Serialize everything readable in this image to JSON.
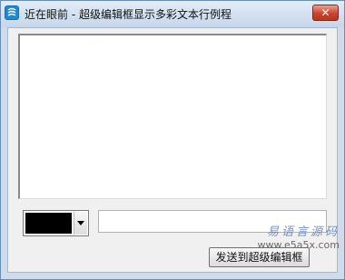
{
  "window": {
    "title": "近在眼前 - 超级编辑框显示多彩文本行例程",
    "close_glyph": "✕",
    "app_icon": "app-icon"
  },
  "editor": {
    "text": ""
  },
  "controls": {
    "selected_color": "#000000",
    "text_input_value": "",
    "send_button_label": "发送到超级编辑框"
  },
  "watermark": {
    "logo_text": "易语言源码",
    "url": "www.e5a5x.com"
  },
  "colors": {
    "title_bg": "#cfdcec",
    "close_button": "#c9452e"
  }
}
